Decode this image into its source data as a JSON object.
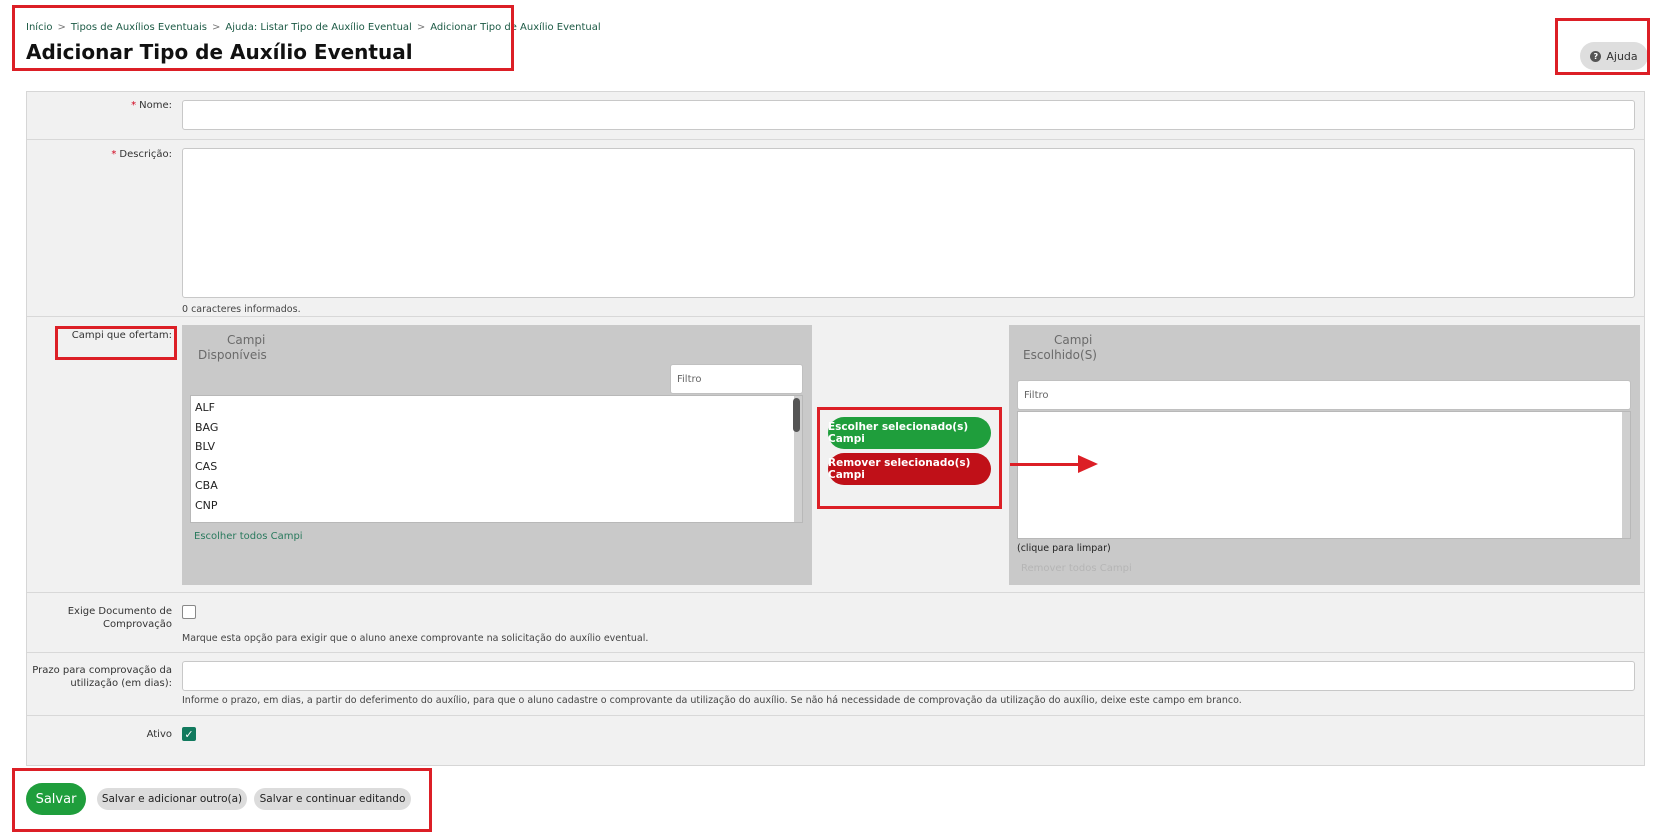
{
  "breadcrumb": [
    {
      "label": "Início"
    },
    {
      "label": "Tipos de Auxílios Eventuais"
    },
    {
      "label": "Ajuda: Listar Tipo de Auxílio Eventual"
    },
    {
      "label": "Adicionar Tipo de Auxílio Eventual"
    }
  ],
  "breadcrumb_separator": ">",
  "page_title": "Adicionar Tipo de Auxílio Eventual",
  "help_button": {
    "label": "Ajuda",
    "icon": "question-circle-icon"
  },
  "form": {
    "required_mark": "*",
    "nome": {
      "label": "Nome:",
      "value": ""
    },
    "descricao": {
      "label": "Descrição:",
      "value": "",
      "counter": "0 caracteres informados."
    },
    "campi": {
      "label": "Campi que ofertam:",
      "available_title": "Campi\nDisponíveis",
      "available_filter_placeholder": "Filtro",
      "available_items": [
        "ALF",
        "BAG",
        "BLV",
        "CAS",
        "CBA",
        "CNP"
      ],
      "choose_all_link": "Escolher todos Campi",
      "choose_button": "Escolher selecionado(s) Campi",
      "remove_button": "Remover selecionado(s) Campi",
      "chosen_title": "Campi\nEscolhido(S)",
      "chosen_filter_placeholder": "Filtro",
      "chosen_items": [],
      "clear_hint": "(clique para limpar)",
      "remove_all_link": "Remover todos Campi"
    },
    "exige_documento": {
      "label_line1": "Exige Documento de",
      "label_line2": "Comprovação",
      "checked": false,
      "help": "Marque esta opção para exigir que o aluno anexe comprovante na solicitação do auxílio eventual."
    },
    "prazo": {
      "label_line1": "Prazo para comprovação da",
      "label_line2": "utilização (em dias):",
      "value": "",
      "help": "Informe o prazo, em dias, a partir do deferimento do auxílio, para que o aluno cadastre o comprovante da utilização do auxílio. Se não há necessidade de comprovação da utilização do auxílio, deixe este campo em branco."
    },
    "ativo": {
      "label": "Ativo",
      "checked": true
    }
  },
  "actions": {
    "save": "Salvar",
    "save_add_another": "Salvar e adicionar outro(a)",
    "save_continue": "Salvar e continuar editando"
  },
  "colors": {
    "accent_green": "#1f9e3c",
    "danger_red": "#c01018",
    "highlight_red": "#dc1f26",
    "link_green": "#2a7a5e"
  }
}
